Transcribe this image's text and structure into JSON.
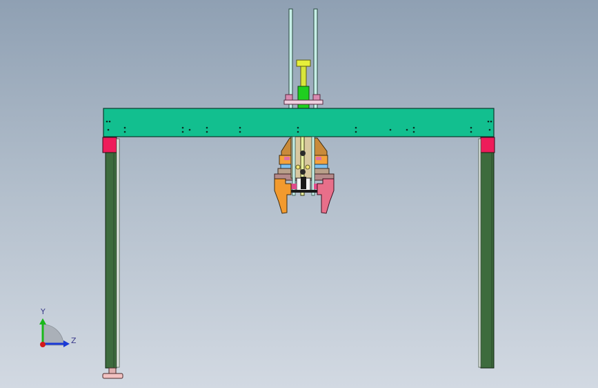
{
  "viewport": {
    "background_top": "#8fa0b3",
    "background_bottom": "#d2d9e2"
  },
  "model": {
    "beam_color": "#12bf8f",
    "leg_color": "#3d6b3d",
    "bracket_color": "#ee1c5a",
    "gripper_left_color": "#f29a2e",
    "gripper_right_color": "#e86f8a",
    "cylinder_color": "#1fcf1f",
    "rod_color": "#c8f0e8"
  },
  "triad": {
    "y_label": "Y",
    "z_label": "Z",
    "y_color": "#1ab81a",
    "z_color": "#1a3ad6",
    "origin_color": "#d41a1a"
  }
}
